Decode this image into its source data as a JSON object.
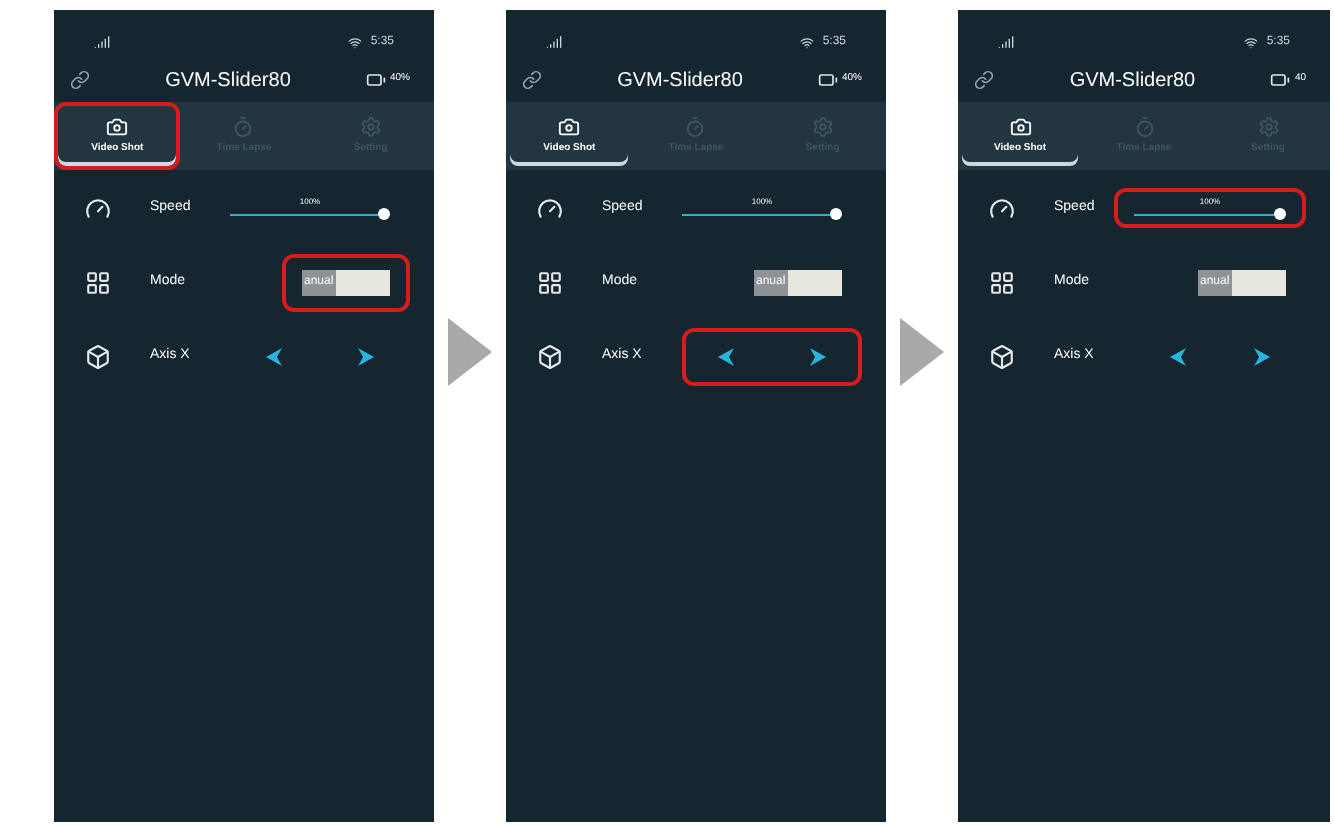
{
  "phones": [
    {
      "status_time": "5:35",
      "title": "GVM-Slider80",
      "battery": "40%",
      "tabs": [
        {
          "label": "Video Shot",
          "selected": true,
          "highlighted": true
        },
        {
          "label": "Time Lapse",
          "selected": false,
          "highlighted": false
        },
        {
          "label": "Setting",
          "selected": false,
          "highlighted": false
        }
      ],
      "speed": {
        "label": "Speed",
        "reading": "100%",
        "level": 1,
        "highlighted": false
      },
      "mode": {
        "label": "Mode",
        "value": "anual",
        "highlighted": true
      },
      "axis": {
        "label": "Axis X",
        "highlighted": false
      }
    },
    {
      "status_time": "5:35",
      "title": "GVM-Slider80",
      "battery": "40%",
      "tabs": [
        {
          "label": "Video Shot",
          "selected": true,
          "highlighted": false
        },
        {
          "label": "Time Lapse",
          "selected": false,
          "highlighted": false
        },
        {
          "label": "Setting",
          "selected": false,
          "highlighted": false
        }
      ],
      "speed": {
        "label": "Speed",
        "reading": "100%",
        "level": 1,
        "highlighted": false
      },
      "mode": {
        "label": "Mode",
        "value": "anual",
        "highlighted": false
      },
      "axis": {
        "label": "Axis X",
        "highlighted": true
      }
    },
    {
      "status_time": "5:35",
      "title": "GVM-Slider80",
      "battery": "40",
      "tabs": [
        {
          "label": "Video Shot",
          "selected": true,
          "highlighted": false
        },
        {
          "label": "Time Lapse",
          "selected": false,
          "highlighted": false
        },
        {
          "label": "Setting",
          "selected": false,
          "highlighted": false
        }
      ],
      "speed": {
        "label": "Speed",
        "reading": "100%",
        "level": 1,
        "highlighted": true
      },
      "mode": {
        "label": "Mode",
        "value": "anual",
        "highlighted": false
      },
      "axis": {
        "label": "Axis X",
        "highlighted": false
      }
    }
  ]
}
